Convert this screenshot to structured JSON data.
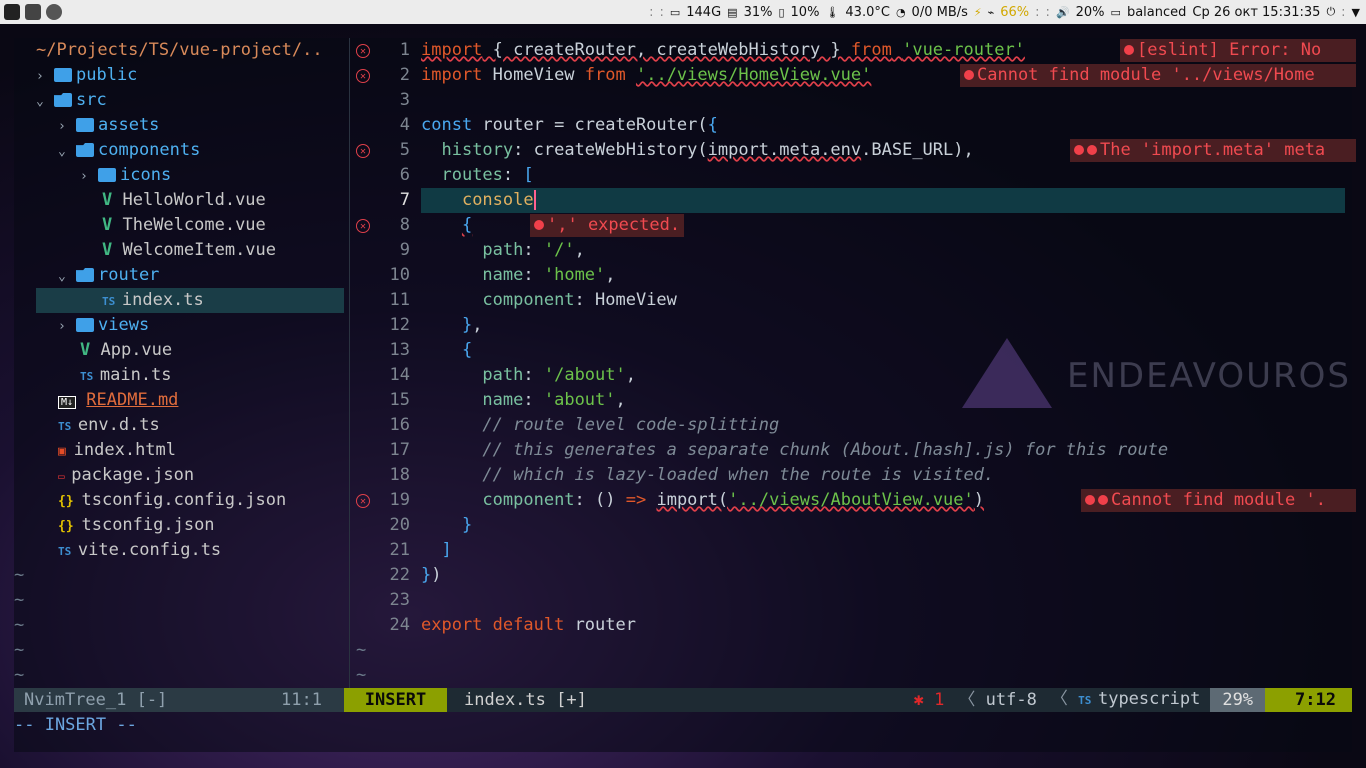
{
  "topbar": {
    "disk": "144G",
    "cpu": "31%",
    "mem": "10%",
    "temp": "43.0°C",
    "net": "0/0 MB/s",
    "battery": "66%",
    "volume": "20%",
    "power_profile": "balanced",
    "datetime": "Ср 26 окт 15:31:35"
  },
  "tree": {
    "title": "~/Projects/TS/vue-project/..",
    "items": [
      {
        "label": "public",
        "kind": "folder",
        "chev": "›"
      },
      {
        "label": "src",
        "kind": "folder-open",
        "chev": "⌄"
      },
      {
        "label": "assets",
        "kind": "folder",
        "chev": "›"
      },
      {
        "label": "components",
        "kind": "folder-open",
        "chev": "⌄"
      },
      {
        "label": "icons",
        "kind": "folder",
        "chev": "›"
      },
      {
        "label": "HelloWorld.vue",
        "kind": "vue"
      },
      {
        "label": "TheWelcome.vue",
        "kind": "vue"
      },
      {
        "label": "WelcomeItem.vue",
        "kind": "vue"
      },
      {
        "label": "router",
        "kind": "folder-open",
        "chev": "⌄"
      },
      {
        "label": "index.ts",
        "kind": "ts"
      },
      {
        "label": "views",
        "kind": "folder",
        "chev": "›"
      },
      {
        "label": "App.vue",
        "kind": "vue"
      },
      {
        "label": "main.ts",
        "kind": "ts"
      },
      {
        "label": "README.md",
        "kind": "md"
      },
      {
        "label": "env.d.ts",
        "kind": "ts"
      },
      {
        "label": "index.html",
        "kind": "html"
      },
      {
        "label": "package.json",
        "kind": "pkg"
      },
      {
        "label": "tsconfig.config.json",
        "kind": "json"
      },
      {
        "label": "tsconfig.json",
        "kind": "json"
      },
      {
        "label": "vite.config.ts",
        "kind": "ts"
      }
    ]
  },
  "editor": {
    "line_numbers": [
      "1",
      "2",
      "3",
      "4",
      "5",
      "6",
      "7",
      "8",
      "9",
      "10",
      "11",
      "12",
      "13",
      "14",
      "15",
      "16",
      "17",
      "18",
      "19",
      "20",
      "21",
      "22",
      "23",
      "24"
    ],
    "diagnostics": {
      "d1": "[eslint] Error: No",
      "d2": "Cannot find module '../views/Home",
      "d5": "The 'import.meta' meta",
      "d8": "',' expected.",
      "d19": "Cannot find module '."
    }
  },
  "statusline": {
    "tree_name": "NvimTree_1 [-]",
    "tree_pos": "11:1",
    "mode": "INSERT",
    "file": "index.ts [+]",
    "errors": "1",
    "encoding": "utf-8",
    "filetype": "typescript",
    "percent": "29%",
    "linecol": "7:12"
  },
  "cmdline": "-- INSERT --",
  "logo": "ENDEAVOUROS"
}
